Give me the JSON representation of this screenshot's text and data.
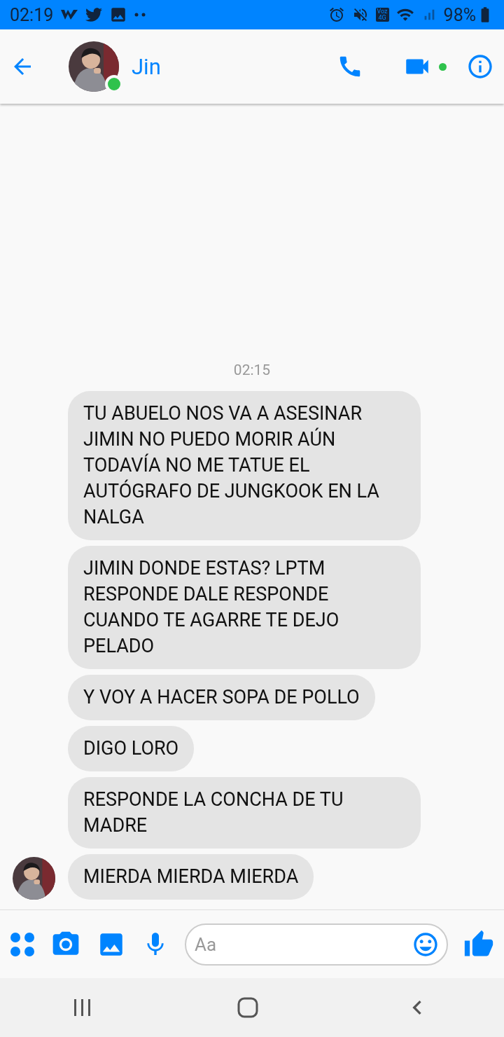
{
  "status_bar": {
    "time": "02:19",
    "network_badge": [
      "Voz",
      "4G"
    ],
    "battery": "98%"
  },
  "header": {
    "contact_name": "Jin",
    "online": true,
    "video_call_active": true
  },
  "chat": {
    "timestamp": "02:15",
    "messages": [
      {
        "text": "TU ABUELO NOS VA A ASESINAR JIMIN NO PUEDO MORIR AÚN TODAVÍA NO ME TATUE EL AUTÓGRAFO DE JUNGKOOK EN LA NALGA",
        "show_avatar": false
      },
      {
        "text": "JIMIN DONDE ESTAS? LPTM RESPONDE DALE RESPONDE CUANDO TE AGARRE TE DEJO PELADO",
        "show_avatar": false
      },
      {
        "text": "Y VOY A HACER SOPA DE POLLO",
        "show_avatar": false
      },
      {
        "text": "DIGO LORO",
        "show_avatar": false
      },
      {
        "text": "RESPONDE LA CONCHA DE TU MADRE",
        "show_avatar": false
      },
      {
        "text": "MIERDA MIERDA MIERDA",
        "show_avatar": true
      }
    ]
  },
  "composer": {
    "placeholder": "Aa"
  }
}
